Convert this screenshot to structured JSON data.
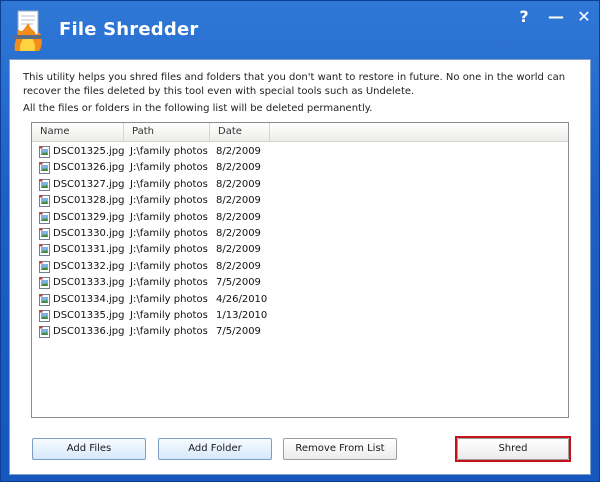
{
  "window": {
    "title": "File Shredder",
    "help_label": "?",
    "minimize_label": "—",
    "close_label": "✕"
  },
  "description": {
    "line1": "This utility helps you shred files and folders that you don't want to restore in future. No one in the world can recover the files deleted by this tool even with special tools such as Undelete.",
    "line2": "All the files or folders in the following list will be deleted permanently."
  },
  "list": {
    "columns": [
      "Name",
      "Path",
      "Date"
    ],
    "rows": [
      {
        "name": "DSC01325.jpg",
        "path": "J:\\family photos",
        "date": "8/2/2009"
      },
      {
        "name": "DSC01326.jpg",
        "path": "J:\\family photos",
        "date": "8/2/2009"
      },
      {
        "name": "DSC01327.jpg",
        "path": "J:\\family photos",
        "date": "8/2/2009"
      },
      {
        "name": "DSC01328.jpg",
        "path": "J:\\family photos",
        "date": "8/2/2009"
      },
      {
        "name": "DSC01329.jpg",
        "path": "J:\\family photos",
        "date": "8/2/2009"
      },
      {
        "name": "DSC01330.jpg",
        "path": "J:\\family photos",
        "date": "8/2/2009"
      },
      {
        "name": "DSC01331.jpg",
        "path": "J:\\family photos",
        "date": "8/2/2009"
      },
      {
        "name": "DSC01332.jpg",
        "path": "J:\\family photos",
        "date": "8/2/2009"
      },
      {
        "name": "DSC01333.jpg",
        "path": "J:\\family photos",
        "date": "7/5/2009"
      },
      {
        "name": "DSC01334.jpg",
        "path": "J:\\family photos",
        "date": "4/26/2010"
      },
      {
        "name": "DSC01335.jpg",
        "path": "J:\\family photos",
        "date": "1/13/2010"
      },
      {
        "name": "DSC01336.jpg",
        "path": "J:\\family photos",
        "date": "7/5/2009"
      }
    ]
  },
  "buttons": {
    "add_files": "Add Files",
    "add_folder": "Add Folder",
    "remove_from_list": "Remove From List",
    "shred": "Shred"
  },
  "colors": {
    "title_bar": "#1e5fc6",
    "highlight": "#c4121d"
  },
  "icons": {
    "app": "shredder-flame-icon",
    "file": "image-file-icon"
  }
}
